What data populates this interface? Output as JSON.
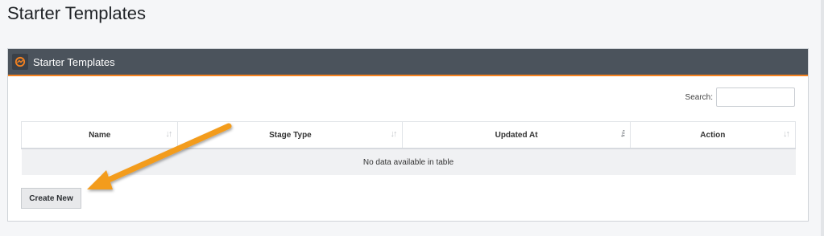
{
  "page": {
    "title": "Starter Templates"
  },
  "panel": {
    "title": "Starter Templates",
    "icon": "template-logo-icon"
  },
  "search": {
    "label": "Search:",
    "value": "",
    "placeholder": ""
  },
  "table": {
    "columns": [
      "Name",
      "Stage Type",
      "Updated At",
      "Action"
    ],
    "sorted_column": "Updated At",
    "empty_message": "No data available in table"
  },
  "actions": {
    "create_label": "Create New"
  },
  "annotation": {
    "type": "arrow",
    "color": "#f39c1e",
    "points_to": "Create New"
  },
  "colors": {
    "header_bg": "#4b535c",
    "accent": "#f58220"
  }
}
